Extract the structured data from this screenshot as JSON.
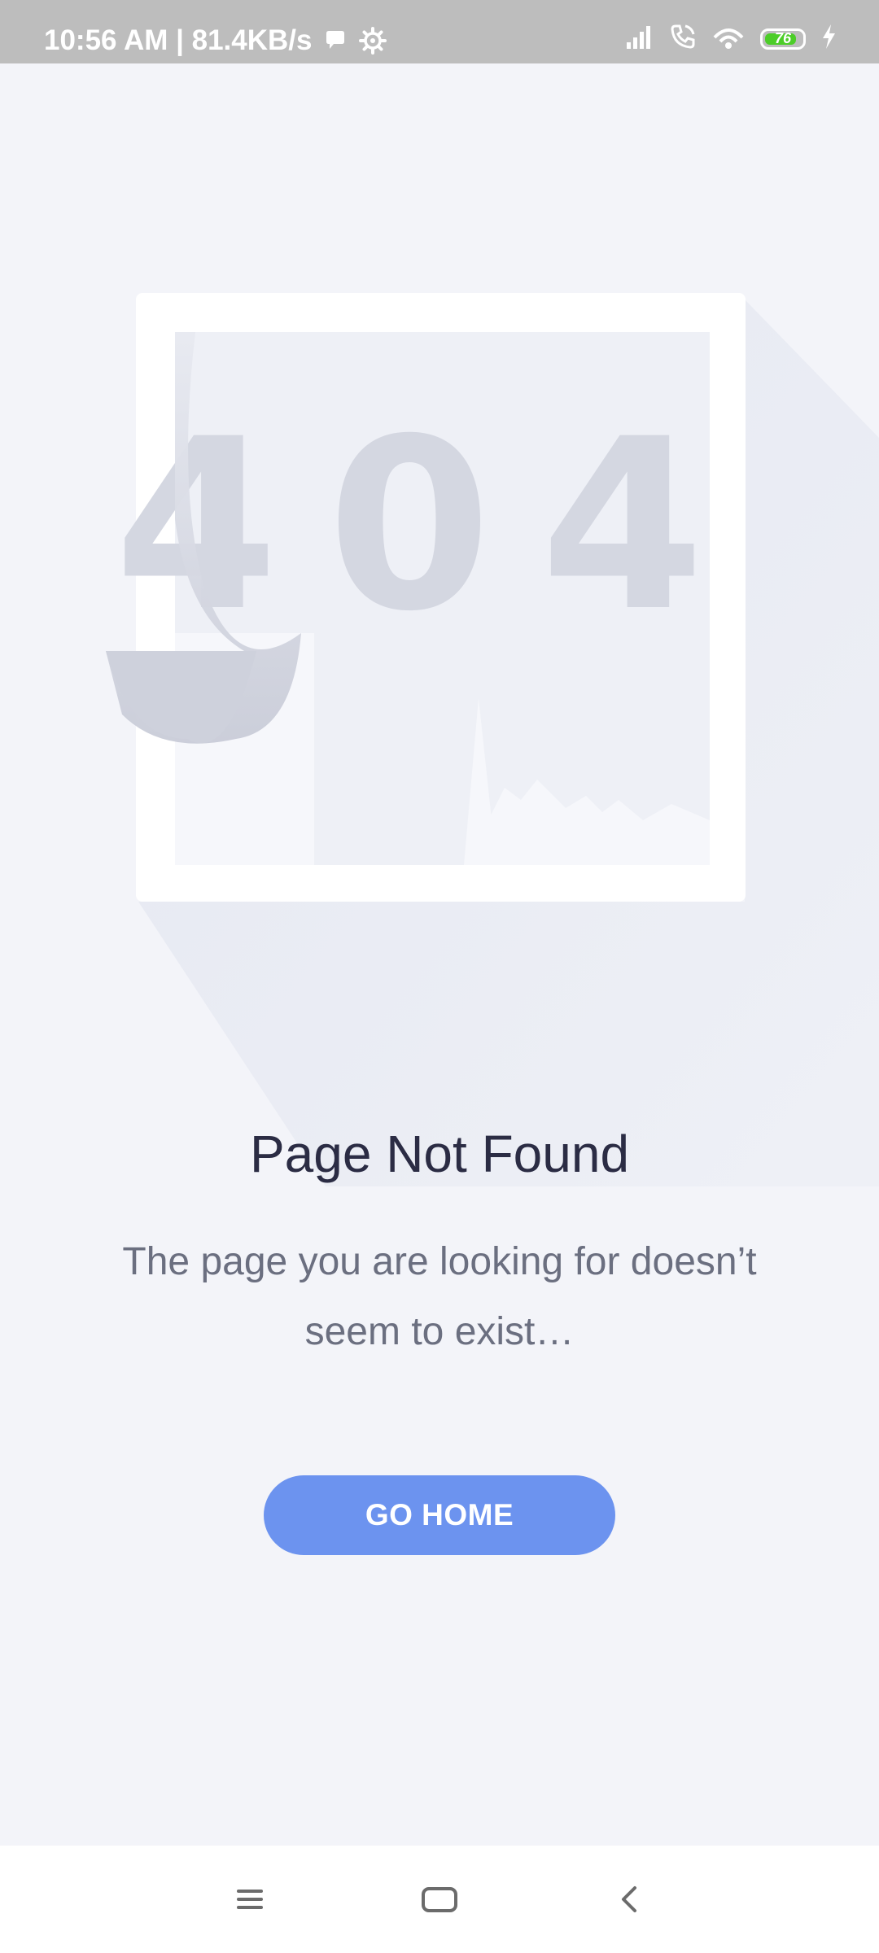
{
  "status_bar": {
    "text": "10:56 AM | 81.4KB/s",
    "battery_level": "76",
    "icons": [
      "chat-bubble-icon",
      "gear-icon",
      "signal-icon",
      "call-icon",
      "hotspot-icon",
      "battery-icon",
      "charging-icon"
    ]
  },
  "illustration": {
    "code": "404"
  },
  "main": {
    "title": "Page Not Found",
    "message": "The page you are looking for doesn’t seem to exist…",
    "button_label": "GO HOME"
  },
  "nav_bar": {
    "icons": [
      "menu-icon",
      "home-icon",
      "back-icon"
    ]
  },
  "colors": {
    "background": "#f3f4f9",
    "status_bar": "#bdbdbd",
    "button": "#6c93ef",
    "title": "#2b2c44",
    "message": "#6b6f80",
    "battery_fill": "#4ccd28"
  }
}
